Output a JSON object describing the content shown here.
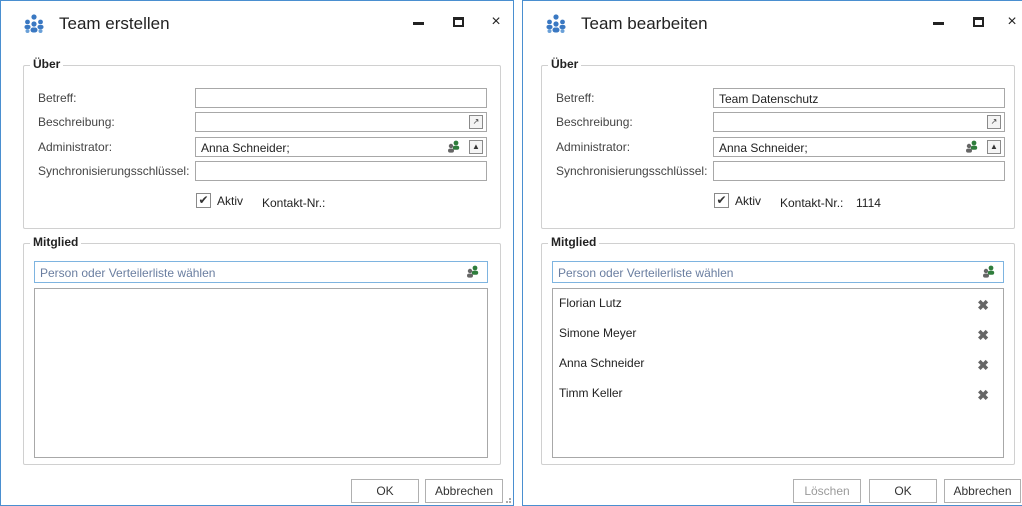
{
  "create": {
    "title": "Team erstellen",
    "controls": {
      "minimize": "",
      "maximize": "",
      "close": "×"
    },
    "about": {
      "legend": "Über",
      "subject_label": "Betreff:",
      "subject_value": "",
      "description_label": "Beschreibung:",
      "description_value": "",
      "admin_label": "Administrator:",
      "admin_value": "Anna Schneider;",
      "sync_label": "Synchronisierungsschlüssel:",
      "sync_value": "",
      "active_label": "Aktiv",
      "active_checked": true,
      "contact_label": "Kontakt-Nr.:",
      "contact_value": ""
    },
    "members": {
      "legend": "Mitglied",
      "search_placeholder": "Person oder Verteilerliste wählen",
      "items": []
    },
    "buttons": {
      "ok": "OK",
      "cancel": "Abbrechen"
    }
  },
  "edit": {
    "title": "Team bearbeiten",
    "controls": {
      "minimize": "",
      "maximize": "",
      "close": "×"
    },
    "about": {
      "legend": "Über",
      "subject_label": "Betreff:",
      "subject_value": "Team Datenschutz",
      "description_label": "Beschreibung:",
      "description_value": "",
      "admin_label": "Administrator:",
      "admin_value": "Anna Schneider;",
      "sync_label": "Synchronisierungsschlüssel:",
      "sync_value": "",
      "active_label": "Aktiv",
      "active_checked": true,
      "contact_label": "Kontakt-Nr.:",
      "contact_value": "1114"
    },
    "members": {
      "legend": "Mitglied",
      "search_placeholder": "Person oder Verteilerliste wählen",
      "items": [
        {
          "name": "Florian Lutz"
        },
        {
          "name": "Simone Meyer"
        },
        {
          "name": "Anna Schneider"
        },
        {
          "name": "Timm Keller"
        }
      ]
    },
    "buttons": {
      "delete": "Löschen",
      "ok": "OK",
      "cancel": "Abbrechen"
    }
  },
  "icons": {
    "app": "team-people-icon",
    "open": "open-external-icon",
    "people_picker": "people-picker-icon",
    "expand": "triangle-up-icon",
    "remove": "remove-x-icon",
    "check": "checkmark-icon"
  },
  "colors": {
    "window_border": "#4a8fd0",
    "search_border": "#7eb4e0",
    "placeholder": "#6a7ea0",
    "icon_blue": "#3a78c2"
  }
}
